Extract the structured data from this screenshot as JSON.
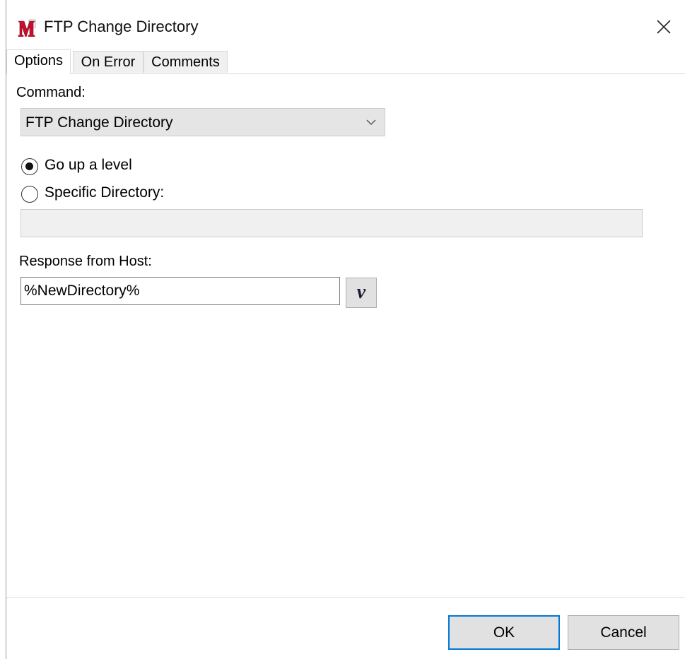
{
  "window": {
    "title": "FTP Change Directory",
    "app_icon": "M",
    "close_icon": "close-icon"
  },
  "tabs": [
    {
      "label": "Options",
      "active": true
    },
    {
      "label": "On Error",
      "active": false
    },
    {
      "label": "Comments",
      "active": false
    }
  ],
  "options": {
    "command_label": "Command:",
    "command_value": "FTP Change Directory",
    "radio_up_label": "Go up a level",
    "radio_up_selected": true,
    "radio_specific_label": "Specific Directory:",
    "radio_specific_selected": false,
    "specific_directory_value": "",
    "response_label": "Response from Host:",
    "response_value": "%NewDirectory%",
    "variable_button_label": "v"
  },
  "footer": {
    "ok_label": "OK",
    "cancel_label": "Cancel"
  },
  "colors": {
    "accent": "#0078d7",
    "icon_red": "#c8102e"
  }
}
